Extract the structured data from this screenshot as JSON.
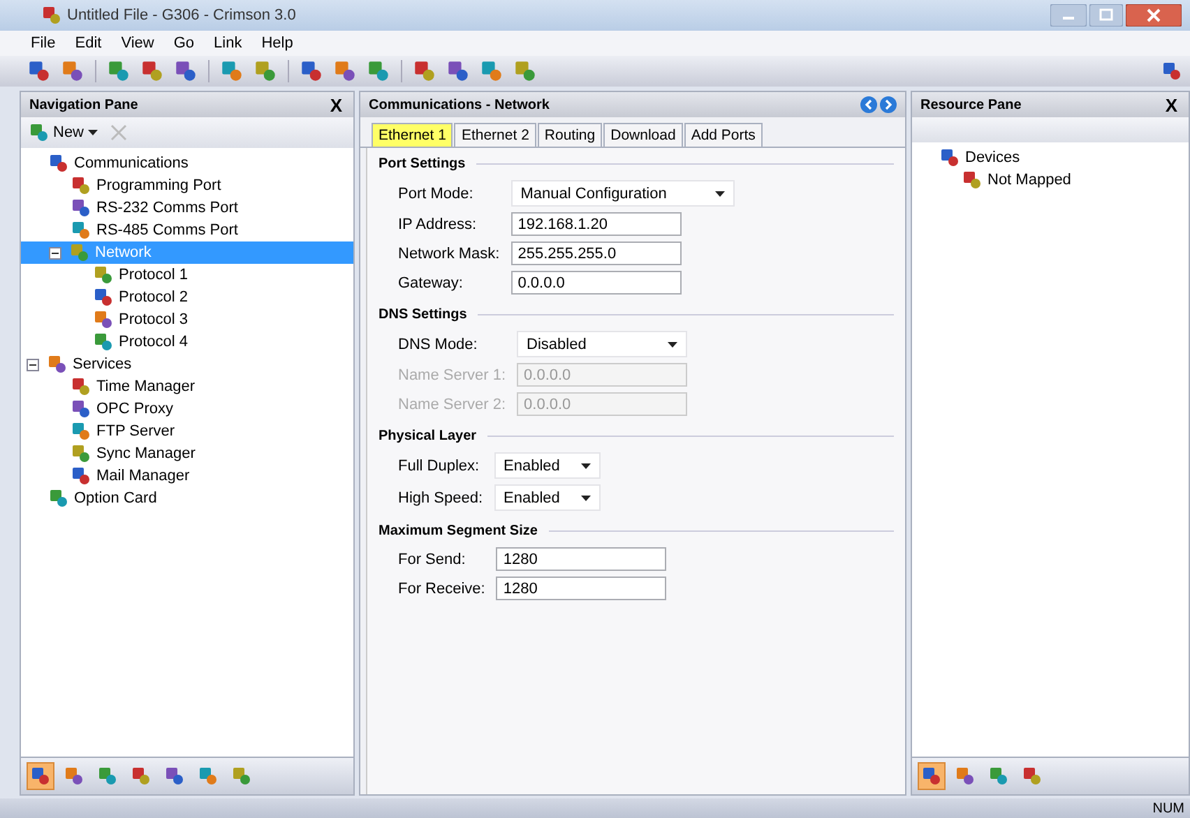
{
  "window": {
    "title": "Untitled File - G306 - Crimson 3.0"
  },
  "menu": [
    "File",
    "Edit",
    "View",
    "Go",
    "Link",
    "Help"
  ],
  "nav_pane": {
    "title": "Navigation Pane",
    "close": "X",
    "new_button": "New",
    "tree": [
      {
        "label": "Communications",
        "selected": false,
        "children": [
          {
            "label": "Programming Port",
            "selected": false
          },
          {
            "label": "RS-232 Comms Port",
            "selected": false
          },
          {
            "label": "RS-485 Comms Port",
            "selected": false
          },
          {
            "label": "Network",
            "expanded": true,
            "selected": true,
            "children": [
              {
                "label": "Protocol 1",
                "selected": false
              },
              {
                "label": "Protocol 2",
                "selected": false
              },
              {
                "label": "Protocol 3",
                "selected": false
              },
              {
                "label": "Protocol 4",
                "selected": false
              }
            ]
          }
        ]
      },
      {
        "label": "Services",
        "expanded": true,
        "selected": false,
        "children": [
          {
            "label": "Time Manager",
            "selected": false
          },
          {
            "label": "OPC Proxy",
            "selected": false
          },
          {
            "label": "FTP Server",
            "selected": false
          },
          {
            "label": "Sync Manager",
            "selected": false
          },
          {
            "label": "Mail Manager",
            "selected": false
          }
        ]
      },
      {
        "label": "Option Card",
        "selected": false
      }
    ],
    "view_buttons": [
      {
        "selected": true
      },
      {
        "selected": false
      },
      {
        "selected": false
      },
      {
        "selected": false
      },
      {
        "selected": false
      },
      {
        "selected": false
      },
      {
        "selected": false
      }
    ]
  },
  "editor": {
    "title": "Communications - Network",
    "tabs": [
      {
        "label": "Ethernet 1",
        "selected": true
      },
      {
        "label": "Ethernet 2",
        "selected": false
      },
      {
        "label": "Routing",
        "selected": false
      },
      {
        "label": "Download",
        "selected": false
      },
      {
        "label": "Add Ports",
        "selected": false
      }
    ],
    "sections": [
      {
        "title": "Port Settings",
        "fields": [
          {
            "label": "Port Mode:",
            "kind": "dropdown",
            "value": "Manual Configuration",
            "disabled": false
          },
          {
            "label": "IP Address:",
            "kind": "text",
            "value": "192.168.1.20",
            "disabled": false
          },
          {
            "label": "Network Mask:",
            "kind": "text",
            "value": "255.255.255.0",
            "disabled": false
          },
          {
            "label": "Gateway:",
            "kind": "text",
            "value": "0.0.0.0",
            "disabled": false
          }
        ]
      },
      {
        "title": "DNS Settings",
        "fields": [
          {
            "label": "DNS Mode:",
            "kind": "dropdown",
            "value": "Disabled",
            "disabled": false
          },
          {
            "label": "Name Server 1:",
            "kind": "text",
            "value": "0.0.0.0",
            "disabled": true
          },
          {
            "label": "Name Server 2:",
            "kind": "text",
            "value": "0.0.0.0",
            "disabled": true
          }
        ]
      },
      {
        "title": "Physical Layer",
        "fields": [
          {
            "label": "Full Duplex:",
            "kind": "dropdown",
            "value": "Enabled",
            "disabled": false
          },
          {
            "label": "High Speed:",
            "kind": "dropdown",
            "value": "Enabled",
            "disabled": false
          }
        ]
      },
      {
        "title": "Maximum Segment Size",
        "fields": [
          {
            "label": "For Send:",
            "kind": "text",
            "value": "1280",
            "disabled": false
          },
          {
            "label": "For Receive:",
            "kind": "text",
            "value": "1280",
            "disabled": false
          }
        ]
      }
    ]
  },
  "resource_pane": {
    "title": "Resource Pane",
    "close": "X",
    "tree": [
      {
        "label": "Devices",
        "selected": false,
        "children": [
          {
            "label": "Not Mapped",
            "selected": false
          }
        ]
      }
    ],
    "view_buttons": [
      {
        "selected": true
      },
      {
        "selected": false
      },
      {
        "selected": false
      },
      {
        "selected": false
      }
    ]
  },
  "status_bar": {
    "indicators": [
      "NUM"
    ]
  }
}
